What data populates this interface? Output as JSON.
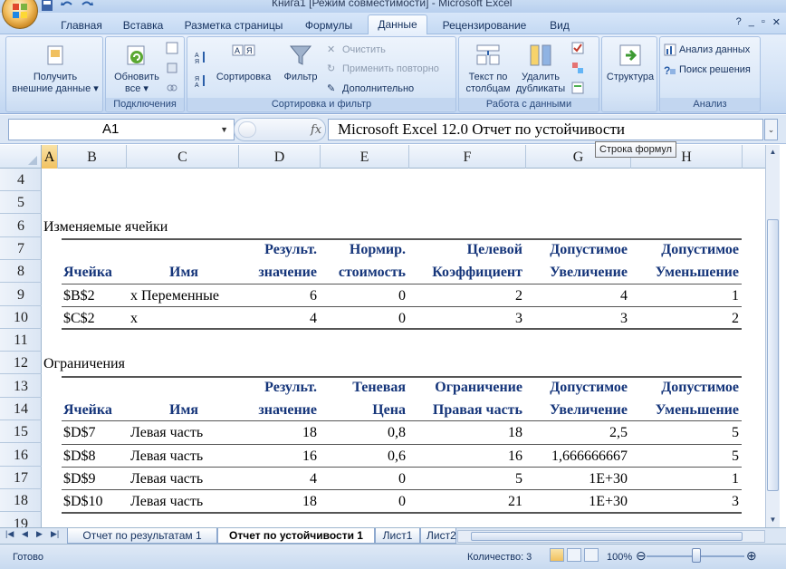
{
  "window": {
    "title": "Книга1 [Режим совместимости] - Microsoft Excel"
  },
  "ribbon_tabs": [
    "Главная",
    "Вставка",
    "Разметка страницы",
    "Формулы",
    "Данные",
    "Рецензирование",
    "Вид"
  ],
  "active_tab": "Данные",
  "ribbon": {
    "get_external": {
      "line1": "Получить",
      "line2": "внешние данные ▾"
    },
    "refresh": {
      "line1": "Обновить",
      "line2": "все ▾"
    },
    "connections_label": "Подключения",
    "sort_az_label": "Сортировка",
    "filter_label": "Фильтр",
    "clear_label": "Очистить",
    "reapply_label": "Применить повторно",
    "advanced_label": "Дополнительно",
    "sortfilter_label": "Сортировка и фильтр",
    "text_to_columns": {
      "line1": "Текст по",
      "line2": "столбцам"
    },
    "remove_dup": {
      "line1": "Удалить",
      "line2": "дубликаты"
    },
    "datatools_label": "Работа с данными",
    "structure_label": "Структура",
    "data_analysis_label": "Анализ данных",
    "solver_label": "Поиск решения",
    "analysis_label": "Анализ"
  },
  "formula_bar": {
    "name_box": "A1",
    "fx": "fx",
    "formula": "Microsoft Excel 12.0 Отчет по устойчивости",
    "tooltip": "Строка формул"
  },
  "columns": [
    "A",
    "B",
    "C",
    "D",
    "E",
    "F",
    "G",
    "H"
  ],
  "rows": [
    "4",
    "5",
    "6",
    "7",
    "8",
    "9",
    "10",
    "11",
    "12",
    "13",
    "14",
    "15",
    "16",
    "17",
    "18",
    "19"
  ],
  "sheet": {
    "section1_title": "Изменяемые ячейки",
    "section1_header": {
      "row1": [
        "Результ.",
        "Нормир.",
        "Целевой",
        "Допустимое",
        "Допустимое"
      ],
      "row2": [
        "Ячейка",
        "Имя",
        "значение",
        "стоимость",
        "Коэффициент",
        "Увеличение",
        "Уменьшение"
      ]
    },
    "section1_rows": [
      [
        "$B$2",
        "x Переменные",
        "6",
        "0",
        "2",
        "4",
        "1"
      ],
      [
        "$C$2",
        "x",
        "4",
        "0",
        "3",
        "3",
        "2"
      ]
    ],
    "section2_title": "Ограничения",
    "section2_header": {
      "row1": [
        "Результ.",
        "Теневая",
        "Ограничение",
        "Допустимое",
        "Допустимое"
      ],
      "row2": [
        "Ячейка",
        "Имя",
        "значение",
        "Цена",
        "Правая часть",
        "Увеличение",
        "Уменьшение"
      ]
    },
    "section2_rows": [
      [
        "$D$7",
        "Левая часть",
        "18",
        "0,8",
        "18",
        "2,5",
        "5"
      ],
      [
        "$D$8",
        "Левая часть",
        "16",
        "0,6",
        "16",
        "1,666666667",
        "5"
      ],
      [
        "$D$9",
        "Левая часть",
        "4",
        "0",
        "5",
        "1E+30",
        "1"
      ],
      [
        "$D$10",
        "Левая часть",
        "18",
        "0",
        "21",
        "1E+30",
        "3"
      ]
    ]
  },
  "sheet_tabs": [
    "Отчет по результатам 1",
    "Отчет по устойчивости 1",
    "Лист1",
    "Лист2"
  ],
  "active_sheet": "Отчет по устойчивости 1",
  "status": {
    "ready": "Готово",
    "count": "Количество: 3",
    "zoom": "100%"
  }
}
